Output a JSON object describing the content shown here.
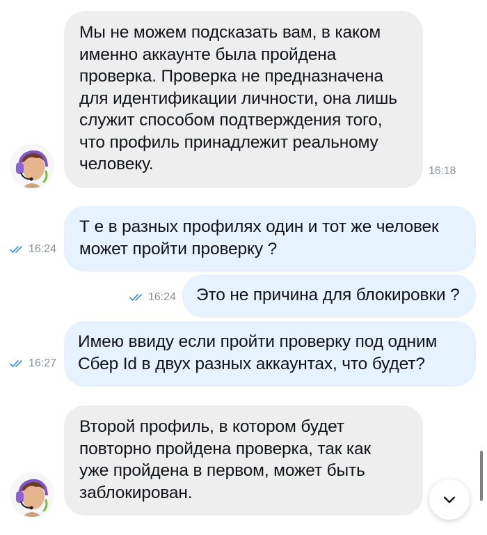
{
  "messages": [
    {
      "direction": "incoming",
      "text": "Мы не можем подсказать вам, в каком\nименно аккаунте была пройдена\nпроверка. Проверка не предназначена\nдля идентификации личности, она лишь\nслужит способом подтверждения того,\nчто профиль принадлежит реальному\nчеловеку.",
      "time": "16:18",
      "avatar": "support-agent-avatar"
    },
    {
      "direction": "outgoing",
      "text": "Т е в разных профилях один и тот же человек\nможет пройти проверку ?",
      "time": "16:24",
      "status": "read"
    },
    {
      "direction": "outgoing",
      "text": "Это не причина для блокировки ?",
      "time": "16:24",
      "status": "read"
    },
    {
      "direction": "outgoing",
      "text": "Имею ввиду если пройти проверку под одним\nСбер Id в двух разных аккаунтах, что будет?",
      "time": "16:27",
      "status": "read"
    },
    {
      "direction": "incoming",
      "text": "Второй профиль, в котором будет\nповторно пройдена проверка, так как\nуже пройдена в первом, может быть\nзаблокирован.",
      "time": "",
      "avatar": "support-agent-avatar"
    }
  ],
  "colors": {
    "incoming_bubble": "#eeeeef",
    "outgoing_bubble": "#e6f2fd",
    "read_check": "#3f93e0",
    "time_text": "#8d9096"
  },
  "icons": {
    "read_status": "double-check-icon",
    "scroll_down": "chevron-down-icon"
  }
}
